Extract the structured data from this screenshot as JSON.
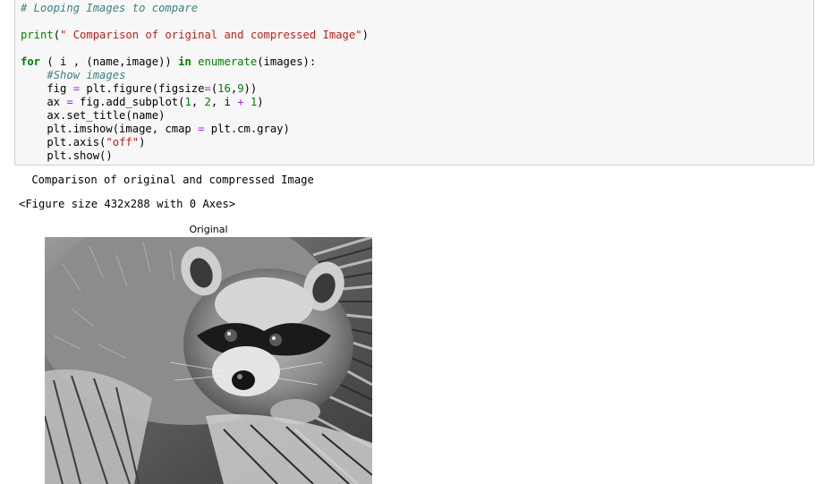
{
  "code_cell": {
    "lines": [
      [
        {
          "t": "# Looping Images to compare",
          "c": "comment"
        }
      ],
      [],
      [
        {
          "t": "print",
          "c": "builtin"
        },
        {
          "t": "(",
          "c": "plain"
        },
        {
          "t": "\" Comparison of original and compressed Image\"",
          "c": "string"
        },
        {
          "t": ")",
          "c": "plain"
        }
      ],
      [],
      [
        {
          "t": "for",
          "c": "keyword"
        },
        {
          "t": " ( i , (name,image)) ",
          "c": "plain"
        },
        {
          "t": "in",
          "c": "keyword"
        },
        {
          "t": " ",
          "c": "plain"
        },
        {
          "t": "enumerate",
          "c": "builtin"
        },
        {
          "t": "(images):",
          "c": "plain"
        }
      ],
      [
        {
          "t": "    ",
          "c": "plain"
        },
        {
          "t": "#Show images",
          "c": "comment"
        }
      ],
      [
        {
          "t": "    fig ",
          "c": "plain"
        },
        {
          "t": "=",
          "c": "op"
        },
        {
          "t": " plt.figure(figsize",
          "c": "plain"
        },
        {
          "t": "=",
          "c": "op"
        },
        {
          "t": "(",
          "c": "plain"
        },
        {
          "t": "16",
          "c": "number"
        },
        {
          "t": ",",
          "c": "plain"
        },
        {
          "t": "9",
          "c": "number"
        },
        {
          "t": "))",
          "c": "plain"
        }
      ],
      [
        {
          "t": "    ax ",
          "c": "plain"
        },
        {
          "t": "=",
          "c": "op"
        },
        {
          "t": " fig.add_subplot(",
          "c": "plain"
        },
        {
          "t": "1",
          "c": "number"
        },
        {
          "t": ", ",
          "c": "plain"
        },
        {
          "t": "2",
          "c": "number"
        },
        {
          "t": ", i ",
          "c": "plain"
        },
        {
          "t": "+",
          "c": "op"
        },
        {
          "t": " ",
          "c": "plain"
        },
        {
          "t": "1",
          "c": "number"
        },
        {
          "t": ")",
          "c": "plain"
        }
      ],
      [
        {
          "t": "    ax.set_title(name)",
          "c": "plain"
        }
      ],
      [
        {
          "t": "    plt.imshow(image, cmap ",
          "c": "plain"
        },
        {
          "t": "=",
          "c": "op"
        },
        {
          "t": " plt.cm.gray)",
          "c": "plain"
        }
      ],
      [
        {
          "t": "    plt.axis(",
          "c": "plain"
        },
        {
          "t": "\"off\"",
          "c": "string"
        },
        {
          "t": ")",
          "c": "plain"
        }
      ],
      [
        {
          "t": "    plt.show()",
          "c": "plain"
        }
      ]
    ]
  },
  "output": {
    "print_text": " Comparison of original and compressed Image",
    "figure_text": "<Figure size 432x288 with 0 Axes>",
    "figure_title": "Original",
    "image_subject": "grayscale-raccoon-photo"
  },
  "colors": {
    "cell_background": "#f7f7f7",
    "cell_border": "#cfcfcf",
    "comment": "#408080",
    "keyword": "#008000",
    "string": "#ba2121",
    "operator": "#aa22ff"
  }
}
